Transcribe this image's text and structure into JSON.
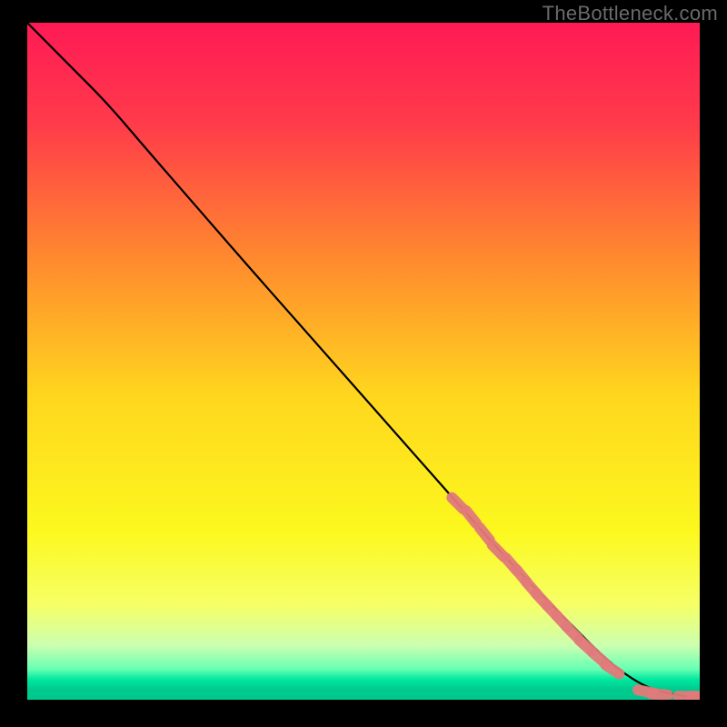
{
  "watermark": "TheBottleneck.com",
  "chart_data": {
    "type": "line",
    "title": "",
    "xlabel": "",
    "ylabel": "",
    "xlim": [
      0,
      100
    ],
    "ylim": [
      0,
      100
    ],
    "grid": false,
    "legend": "none",
    "background_gradient": {
      "stops": [
        {
          "pos": 0.0,
          "color": "#ff1a55"
        },
        {
          "pos": 0.15,
          "color": "#ff3b4a"
        },
        {
          "pos": 0.35,
          "color": "#ff8a2e"
        },
        {
          "pos": 0.55,
          "color": "#ffd61e"
        },
        {
          "pos": 0.75,
          "color": "#fcf81e"
        },
        {
          "pos": 0.86,
          "color": "#f6ff66"
        },
        {
          "pos": 0.92,
          "color": "#ccffb0"
        },
        {
          "pos": 0.955,
          "color": "#66ffb3"
        },
        {
          "pos": 0.97,
          "color": "#00e8a0"
        },
        {
          "pos": 0.985,
          "color": "#00c98e"
        },
        {
          "pos": 1.0,
          "color": "#00c98e"
        }
      ]
    },
    "curve": {
      "note": "Main black curve. Values estimated from pixel positions, normalized 0-100 on each axis (y=0 at bottom).",
      "x": [
        0,
        3,
        7,
        12,
        18,
        25,
        32,
        40,
        48,
        56,
        64,
        72,
        80,
        86,
        90,
        93,
        96,
        98,
        100
      ],
      "y": [
        100,
        97,
        93,
        88,
        81,
        73,
        65,
        56,
        47,
        38,
        29,
        20,
        12,
        6,
        3,
        1.5,
        0.8,
        0.5,
        0.5
      ]
    },
    "highlight_points": {
      "note": "Salmon highlighted segment markers along lower-right portion of curve.",
      "color": "#e27a7a",
      "points": [
        {
          "x": 64,
          "y": 29
        },
        {
          "x": 66,
          "y": 27
        },
        {
          "x": 68,
          "y": 24.5
        },
        {
          "x": 70,
          "y": 22
        },
        {
          "x": 72,
          "y": 20
        },
        {
          "x": 73.5,
          "y": 18.3
        },
        {
          "x": 75,
          "y": 16.5
        },
        {
          "x": 76.5,
          "y": 14.8
        },
        {
          "x": 78,
          "y": 13.2
        },
        {
          "x": 79.5,
          "y": 11.6
        },
        {
          "x": 81,
          "y": 10
        },
        {
          "x": 83,
          "y": 8
        },
        {
          "x": 85,
          "y": 6.2
        },
        {
          "x": 87,
          "y": 4.5
        },
        {
          "x": 92,
          "y": 1.2
        },
        {
          "x": 94,
          "y": 0.8
        },
        {
          "x": 98,
          "y": 0.5
        },
        {
          "x": 100,
          "y": 0.5
        }
      ]
    }
  }
}
